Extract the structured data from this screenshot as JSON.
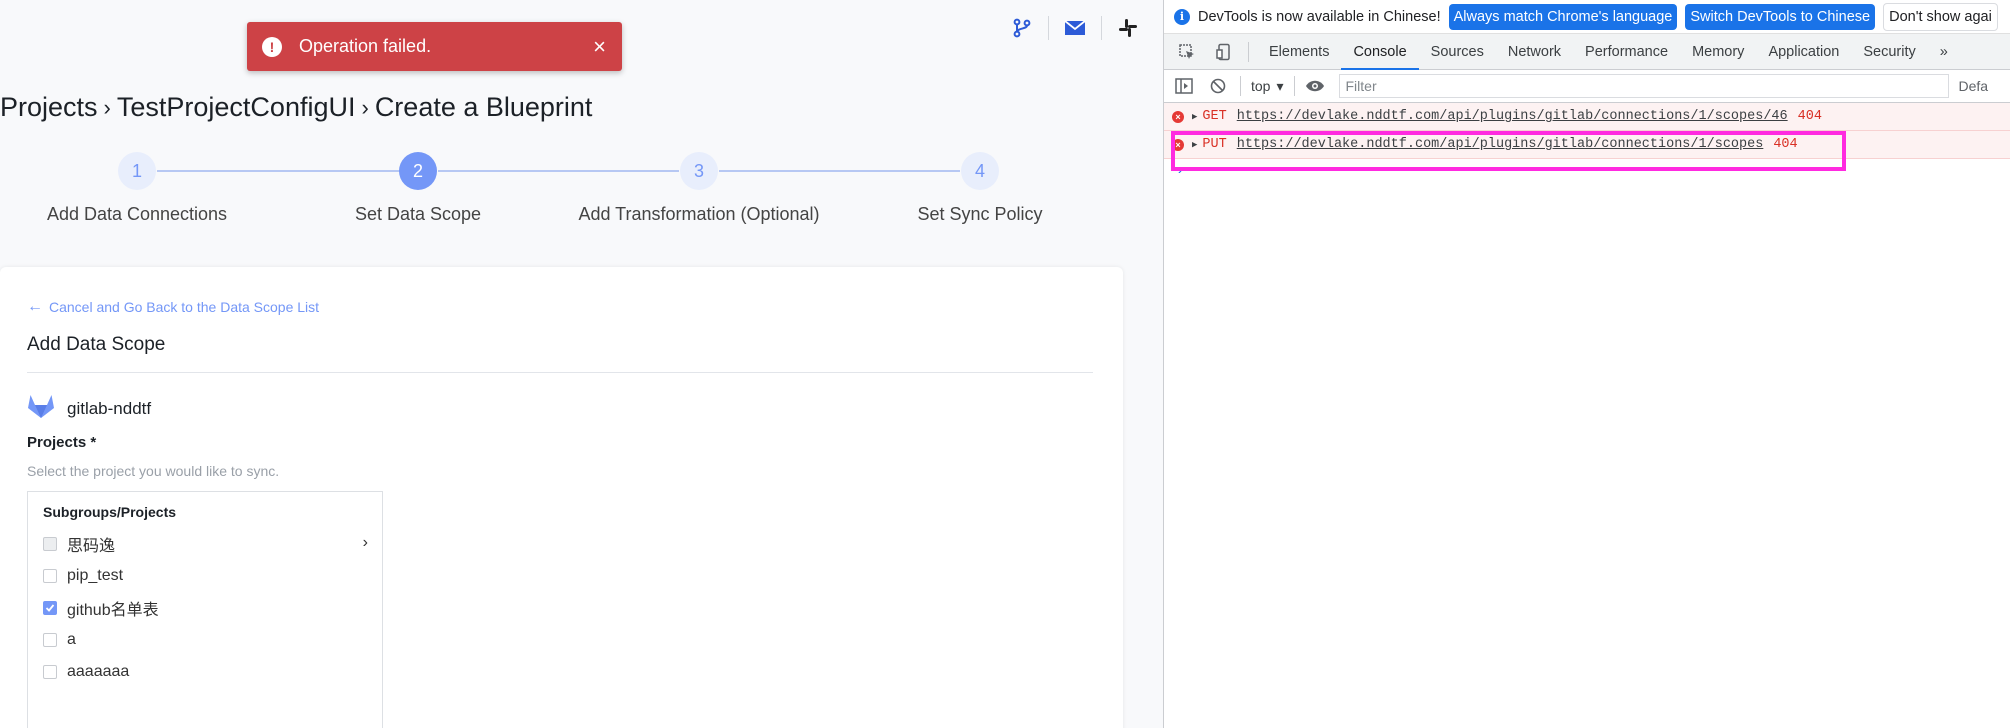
{
  "toast": {
    "message": "Operation failed.",
    "error_icon": "!",
    "close_icon": "×"
  },
  "breadcrumb": {
    "items": [
      "Projects",
      "TestProjectConfigUI",
      "Create a Blueprint"
    ],
    "separator": "›"
  },
  "steps": [
    {
      "num": "1",
      "label": "Add Data Connections"
    },
    {
      "num": "2",
      "label": "Set Data Scope"
    },
    {
      "num": "3",
      "label": "Add Transformation (Optional)"
    },
    {
      "num": "4",
      "label": "Set Sync Policy"
    }
  ],
  "active_step": 2,
  "card": {
    "back_link": "Cancel and Go Back to the Data Scope List",
    "back_arrow": "←",
    "title": "Add Data Scope",
    "connection_name": "gitlab-nddtf",
    "projects_label": "Projects *",
    "projects_hint": "Select the project you would like to sync.",
    "list_header": "Subgroups/Projects",
    "projects": [
      {
        "name": "思码逸",
        "state": "disabled",
        "has_children": true
      },
      {
        "name": "pip_test",
        "state": "unchecked",
        "has_children": false
      },
      {
        "name": "github名单表",
        "state": "checked",
        "has_children": false
      },
      {
        "name": "a",
        "state": "unchecked",
        "has_children": false
      },
      {
        "name": "aaaaaaa",
        "state": "unchecked",
        "has_children": false
      }
    ],
    "expand_arrow": "›"
  },
  "devtools": {
    "info_text": "DevTools is now available in Chinese!",
    "info_icon": "i",
    "btn_match": "Always match Chrome's language",
    "btn_switch": "Switch DevTools to Chinese",
    "btn_dont_show": "Don't show agai",
    "tabs": [
      "Elements",
      "Console",
      "Sources",
      "Network",
      "Performance",
      "Memory",
      "Application",
      "Security"
    ],
    "active_tab": "Console",
    "more_tabs": "»",
    "context": "top",
    "context_caret": "▾",
    "filter_placeholder": "Filter",
    "levels": "Defa",
    "logs": [
      {
        "method": "GET",
        "url": "https://devlake.nddtf.com/api/plugins/gitlab/connections/1/scopes/46",
        "status": "404"
      },
      {
        "method": "PUT",
        "url": "https://devlake.nddtf.com/api/plugins/gitlab/connections/1/scopes",
        "status": "404"
      }
    ],
    "prompt": "›",
    "error_icon": "×",
    "expand_triangle": "▶"
  },
  "colors": {
    "accent": "#7497f7",
    "toast_bg": "#cd4246",
    "devtools_blue": "#1a73e8",
    "error_red": "#d93025",
    "highlight": "#ff2ae0"
  }
}
